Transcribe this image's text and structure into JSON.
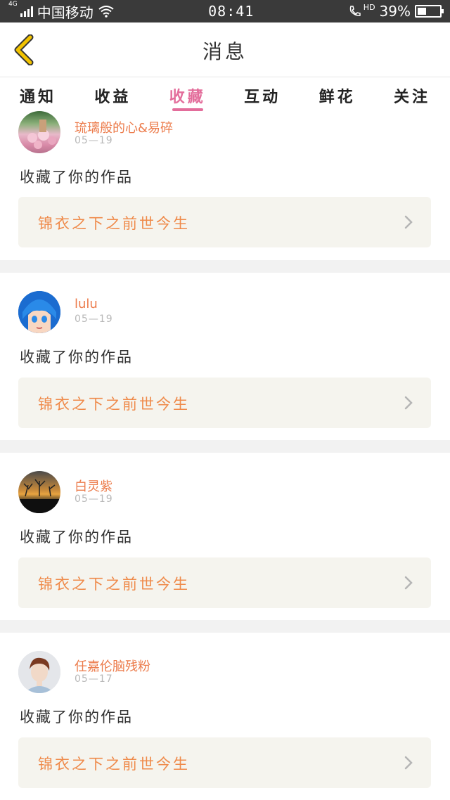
{
  "status_bar": {
    "network": "4G",
    "carrier": "中国移动",
    "time": "08:41",
    "hd": "HD",
    "battery": "39%",
    "battery_level": 0.39
  },
  "nav": {
    "title": "消息",
    "back_icon": "chevron-left-icon",
    "back_color": "#f2c300"
  },
  "tabs": [
    {
      "label": "通知",
      "active": false
    },
    {
      "label": "收益",
      "active": false
    },
    {
      "label": "收藏",
      "active": true
    },
    {
      "label": "互动",
      "active": false
    },
    {
      "label": "鲜花",
      "active": false
    },
    {
      "label": "关注",
      "active": false
    }
  ],
  "colors": {
    "accent_tab": "#e36d9b",
    "username": "#ec7c4c",
    "work_title": "#ef8a4a",
    "card_link_bg": "#f5f4ee"
  },
  "items": [
    {
      "username": "琉璃般的心&易碎",
      "date": "05—19",
      "action": "收藏了你的作品",
      "work": "锦衣之下之前世今生"
    },
    {
      "username": "lulu",
      "date": "05—19",
      "action": "收藏了你的作品",
      "work": "锦衣之下之前世今生"
    },
    {
      "username": "白灵紫",
      "date": "05—19",
      "action": "收藏了你的作品",
      "work": "锦衣之下之前世今生"
    },
    {
      "username": "任嘉伦脑残粉",
      "date": "05—17",
      "action": "收藏了你的作品",
      "work": "锦衣之下之前世今生"
    }
  ]
}
